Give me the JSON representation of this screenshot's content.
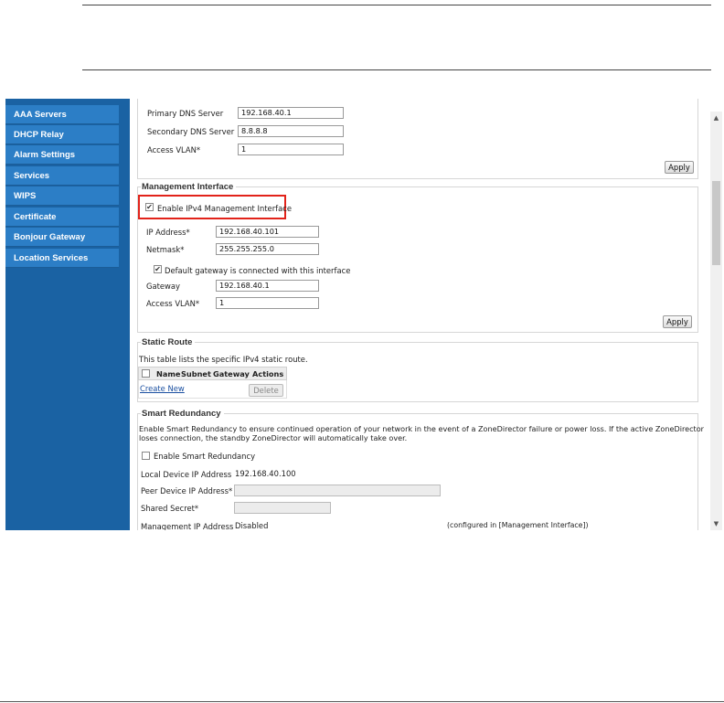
{
  "sidebar": {
    "items": [
      {
        "label": "AAA Servers"
      },
      {
        "label": "DHCP Relay"
      },
      {
        "label": "Alarm Settings"
      },
      {
        "label": "Services"
      },
      {
        "label": "WIPS"
      },
      {
        "label": "Certificate"
      },
      {
        "label": "Bonjour Gateway"
      },
      {
        "label": "Location Services"
      }
    ]
  },
  "dns": {
    "primary_label": "Primary DNS Server",
    "primary_value": "192.168.40.1",
    "secondary_label": "Secondary DNS Server",
    "secondary_value": "8.8.8.8",
    "vlan_label": "Access VLAN*",
    "vlan_value": "1",
    "apply_label": "Apply"
  },
  "management": {
    "title": "Management Interface",
    "enable_label": "Enable IPv4 Management Interface",
    "enable_checked": "✔",
    "ip_label": "IP Address*",
    "ip_value": "192.168.40.101",
    "netmask_label": "Netmask*",
    "netmask_value": "255.255.255.0",
    "default_gw_label": "Default gateway is connected with this interface",
    "default_gw_checked": "✔",
    "gateway_label": "Gateway",
    "gateway_value": "192.168.40.1",
    "vlan_label": "Access VLAN*",
    "vlan_value": "1",
    "apply_label": "Apply"
  },
  "static_route": {
    "title": "Static Route",
    "description": "This table lists the specific IPv4 static route.",
    "columns": [
      "Name",
      "Subnet",
      "Gateway",
      "Actions"
    ],
    "create_label": "Create New",
    "delete_label": "Delete"
  },
  "smart_redundancy": {
    "title": "Smart Redundancy",
    "description_line1": "Enable Smart Redundancy to ensure continued operation of your network in the event of a ZoneDirector failure or power loss. If the active ZoneDirector",
    "description_line2": "loses connection, the standby ZoneDirector will automatically take over.",
    "enable_label": "Enable Smart Redundancy",
    "local_ip_label": "Local Device IP Address",
    "local_ip_value": "192.168.40.100",
    "peer_ip_label": "Peer Device IP Address*",
    "secret_label": "Shared Secret*",
    "mgmt_ip_label": "Management IP Address",
    "mgmt_ip_value": "Disabled",
    "mgmt_note": "(configured in [Management Interface])"
  }
}
